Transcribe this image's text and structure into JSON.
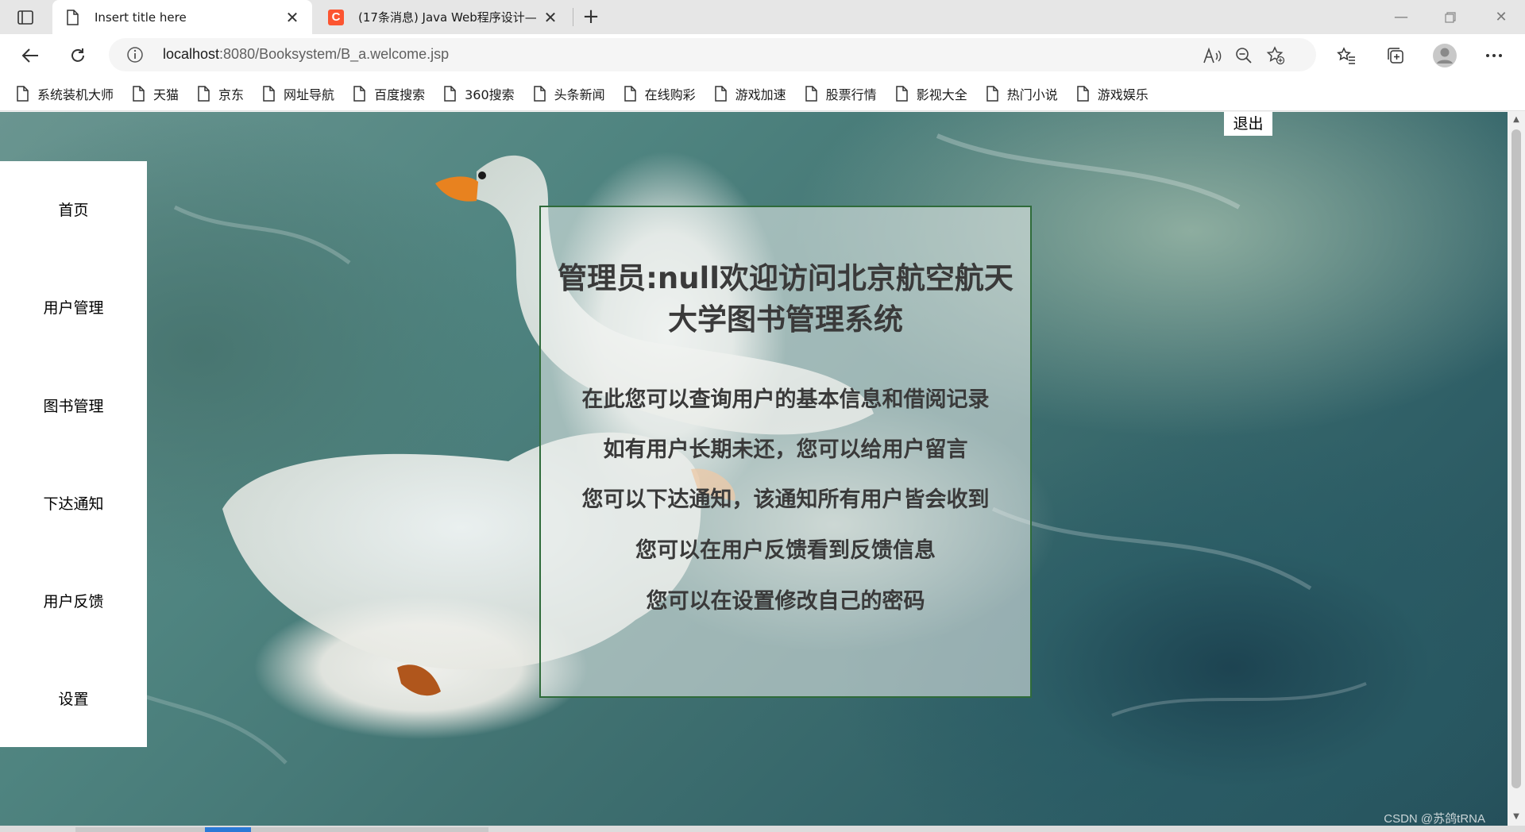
{
  "browser": {
    "tabs": [
      {
        "title": "Insert title here",
        "active": true,
        "icon": "page-icon"
      },
      {
        "title": "(17条消息) Java Web程序设计—",
        "active": false,
        "icon": "csdn-logo",
        "logo_text": "C"
      }
    ],
    "new_tab": "+",
    "address": {
      "host": "localhost",
      "rest": ":8080/Booksystem/B_a.welcome.jsp"
    },
    "icons": [
      "back-icon",
      "refresh-icon",
      "info-icon",
      "read-aloud-icon",
      "zoom-out-icon",
      "add-favorite-icon",
      "favorites-icon",
      "collections-icon",
      "profile-icon",
      "more-icon"
    ]
  },
  "bookmarks": [
    "系统装机大师",
    "天猫",
    "京东",
    "网址导航",
    "百度搜索",
    "360搜索",
    "头条新闻",
    "在线购彩",
    "游戏加速",
    "股票行情",
    "影视大全",
    "热门小说",
    "游戏娱乐"
  ],
  "page": {
    "logout": "退出",
    "nav": [
      "首页",
      "用户管理",
      "图书管理",
      "下达通知",
      "用户反馈",
      "设置"
    ],
    "welcome_title": "管理员:null欢迎访问北京航空航天大学图书管理系统",
    "welcome_lines": [
      "在此您可以查询用户的基本信息和借阅记录",
      "如有用户长期未还，您可以给用户留言",
      "您可以下达通知，该通知所有用户皆会收到",
      "您可以在用户反馈看到反馈信息",
      "您可以在设置修改自己的密码"
    ],
    "watermark": "CSDN @苏鸽tRNA"
  },
  "colors": {
    "panel_border": "#2f6b3a",
    "tab_strip": "#e6e6e6",
    "accent": "#2b79d6"
  }
}
